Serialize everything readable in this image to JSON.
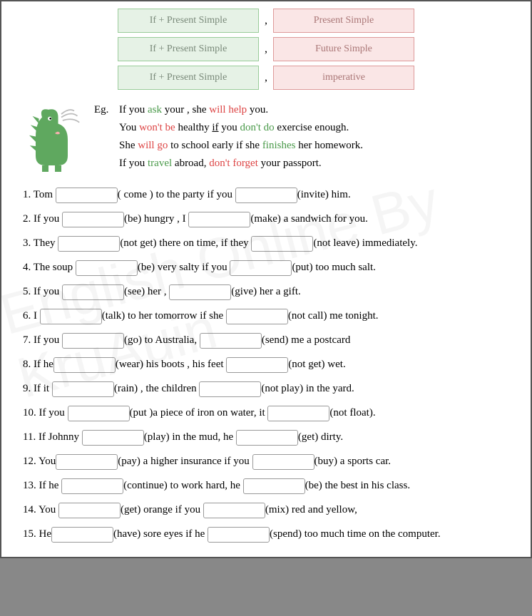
{
  "rules": [
    {
      "l": "If + Present Simple",
      "r": "Present Simple"
    },
    {
      "l": "If + Present Simple",
      "r": "Future Simple"
    },
    {
      "l": "If + Present Simple",
      "r": "imperative"
    }
  ],
  "eg_label": "Eg.",
  "eg": [
    [
      {
        "t": "If you "
      },
      {
        "t": "ask",
        "c": "g"
      },
      {
        "t": " your , she "
      },
      {
        "t": "will help",
        "c": "r"
      },
      {
        "t": " you."
      }
    ],
    [
      {
        "t": "You "
      },
      {
        "t": "won't be",
        "c": "r"
      },
      {
        "t": " healthy  "
      },
      {
        "t": "if",
        "u": 1
      },
      {
        "t": "  you "
      },
      {
        "t": "don't do",
        "c": "g"
      },
      {
        "t": " exercise enough."
      }
    ],
    [
      {
        "t": "She "
      },
      {
        "t": "will go",
        "c": "r"
      },
      {
        "t": " to school early if she "
      },
      {
        "t": "finishes",
        "c": "g"
      },
      {
        "t": " her homework."
      }
    ],
    [
      {
        "t": "If you "
      },
      {
        "t": "travel",
        "c": "g"
      },
      {
        "t": " abroad, "
      },
      {
        "t": "don't forget",
        "c": "r"
      },
      {
        "t": " your passport."
      }
    ]
  ],
  "q": [
    [
      "1. Tom ",
      0,
      "( come ) to the party if you ",
      0,
      "(invite) him."
    ],
    [
      "2. If you ",
      0,
      "(be) hungry , I ",
      0,
      "(make) a sandwich for you."
    ],
    [
      "3. They ",
      0,
      "(not get) there on time, if they ",
      0,
      "(not leave) immediately."
    ],
    [
      "4. The soup ",
      0,
      "(be) very salty if you ",
      0,
      "(put) too much salt."
    ],
    [
      "5. If you ",
      0,
      "(see) her , ",
      0,
      "(give) her a gift."
    ],
    [
      "6. I ",
      0,
      "(talk) to her tomorrow if she ",
      0,
      "(not call) me tonight."
    ],
    [
      "7. If you ",
      0,
      "(go) to Australia, ",
      0,
      "(send) me a postcard"
    ],
    [
      "8. If he",
      0,
      "(wear) his boots , his feet ",
      0,
      "(not get) wet."
    ],
    [
      "9. If it ",
      0,
      "(rain) , the children ",
      0,
      "(not play) in the yard."
    ],
    [
      "10. If you ",
      0,
      "(put )a piece of iron on water, it ",
      0,
      "(not float)."
    ],
    [
      "11. If Johnny ",
      0,
      "(play) in the mud, he ",
      0,
      "(get) dirty."
    ],
    [
      "12. You",
      0,
      "(pay) a higher insurance if you ",
      0,
      "(buy) a sports car."
    ],
    [
      "13. If he ",
      0,
      "(continue) to work hard, he ",
      0,
      "(be) the best in his class."
    ],
    [
      "14. You ",
      0,
      "(get) orange if you ",
      0,
      "(mix) red and yellow,"
    ],
    [
      "15. He",
      0,
      "(have) sore eyes if he ",
      0,
      "(spend) too much time on the computer."
    ]
  ],
  "watermark": "English Online By KruAuin"
}
